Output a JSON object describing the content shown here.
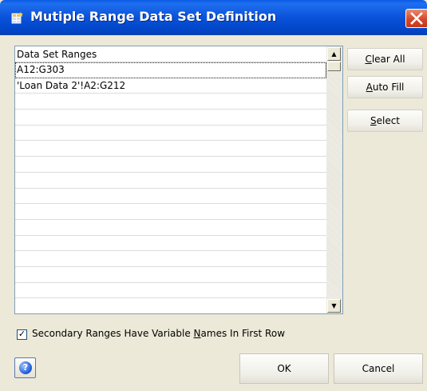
{
  "window": {
    "title": "Mutiple Range Data Set Definition"
  },
  "list": {
    "header": "Data Set Ranges",
    "rows": [
      "A12:G303",
      "'Loan Data 2'!A2:G212",
      "",
      "",
      "",
      "",
      "",
      "",
      "",
      "",
      "",
      "",
      "",
      "",
      "",
      ""
    ]
  },
  "buttons": {
    "clear_all": {
      "pre": "",
      "key": "C",
      "post": "lear All"
    },
    "auto_fill": {
      "pre": "",
      "key": "A",
      "post": "uto Fill"
    },
    "select": {
      "pre": "",
      "key": "S",
      "post": "elect"
    },
    "ok": "OK",
    "cancel": "Cancel"
  },
  "checkbox": {
    "checked": true,
    "mark": "✓",
    "label_pre": "Secondary Ranges Have Variable ",
    "label_key": "N",
    "label_post": "ames In First Row"
  },
  "scrollbar": {
    "up_arrow": "▲",
    "down_arrow": "▼"
  },
  "icons": {
    "help": "?",
    "close": "×"
  },
  "colors": {
    "title_bar": "#0a52da",
    "close_button": "#d5482a",
    "dialog_bg": "#ece9d8"
  }
}
